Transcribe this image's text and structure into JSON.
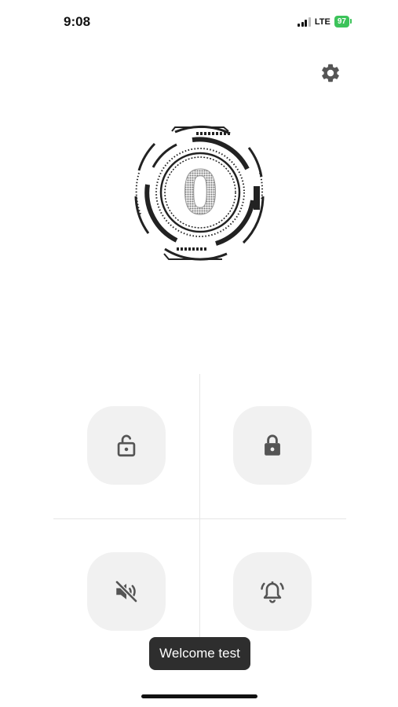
{
  "status_bar": {
    "time": "9:08",
    "network": "LTE",
    "battery": "97"
  },
  "icons": {
    "settings": "gear-icon",
    "unlock": "unlock-icon",
    "lock": "lock-icon",
    "mute": "speaker-mute-icon",
    "alarm": "alarm-bell-icon"
  },
  "logo": {
    "letter": "0"
  },
  "toast": {
    "text": "Welcome test"
  },
  "colors": {
    "battery": "#3cc35a",
    "tile_background": "#f1f1f1",
    "icon": "#555555",
    "toast_background": "#2e2e2e"
  }
}
